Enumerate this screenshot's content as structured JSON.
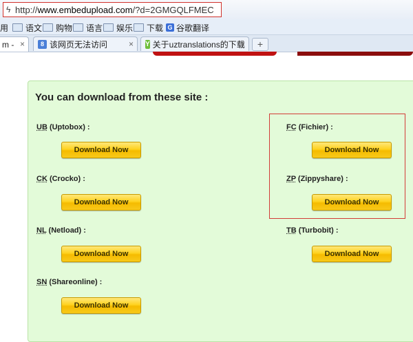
{
  "browser": {
    "url_prefix": "http://",
    "url_host": "www.embedupload.com",
    "url_path": "/?d=2GMGQLFMEC",
    "bookmarks": [
      "用",
      "语文",
      "购物",
      "语言",
      "娱乐",
      "下载",
      "谷歌翻译"
    ],
    "tabs": [
      {
        "label": "m - ",
        "active": true
      },
      {
        "label": "该网页无法访问",
        "active": false
      },
      {
        "label": "关于uztranslations的下载",
        "active": false
      }
    ],
    "new_tab": "+",
    "close_glyph": "×"
  },
  "page": {
    "heading": "You can download from these site :",
    "button_label": "Download Now",
    "hosts": [
      {
        "abbr": "UB",
        "name": " (Uptobox) :"
      },
      {
        "abbr": "CK",
        "name": " (Crocko) :"
      },
      {
        "abbr": "NL",
        "name": " (Netload) :"
      },
      {
        "abbr": "SN",
        "name": " (Shareonline) :"
      },
      {
        "abbr": "FC",
        "name": " (Fichier) :"
      },
      {
        "abbr": "ZP",
        "name": " (Zippyshare) :"
      },
      {
        "abbr": "TB",
        "name": " (Turbobit) :"
      }
    ]
  },
  "colors": {
    "panel_bg": "#e3fbd9",
    "button_gold": "#ffd21f",
    "highlight_red": "#d23b36"
  }
}
